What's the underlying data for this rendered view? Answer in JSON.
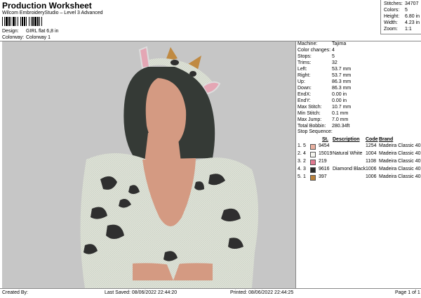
{
  "header": {
    "title": "Production Worksheet",
    "software": "Wilcom EmbroideryStudio – Level 3 Advanced",
    "design_label": "Design:",
    "design_value": "GIRL flat 6,8 in",
    "colorway_label": "Colorway:",
    "colorway_value": "Colorway 1"
  },
  "stats": [
    {
      "label": "Stitches:",
      "value": "34707"
    },
    {
      "label": "Colors:",
      "value": "5"
    },
    {
      "label": "Height:",
      "value": "6.80 in"
    },
    {
      "label": "Width:",
      "value": "4.23 in"
    },
    {
      "label": "Zoom:",
      "value": "1:1"
    }
  ],
  "info": [
    {
      "label": "Machine:",
      "value": "Tajima"
    },
    {
      "label": "Color changes:",
      "value": "4"
    },
    {
      "label": "Stops:",
      "value": "5"
    },
    {
      "label": "Trims:",
      "value": "32"
    },
    {
      "label": "Left:",
      "value": "53.7 mm"
    },
    {
      "label": "Right:",
      "value": "53.7 mm"
    },
    {
      "label": "Up:",
      "value": "86.3 mm"
    },
    {
      "label": "Down:",
      "value": "86.3 mm"
    },
    {
      "label": "EndX:",
      "value": "0.00 in"
    },
    {
      "label": "EndY:",
      "value": "0.00 in"
    },
    {
      "label": "Max Stitch:",
      "value": "10.7 mm"
    },
    {
      "label": "Min Stitch:",
      "value": "0.1 mm"
    },
    {
      "label": "Max Jump:",
      "value": "7.0 mm"
    },
    {
      "label": "Total Bobbin:",
      "value": "280.34ft"
    }
  ],
  "stop_sequence": {
    "title": "Stop Sequence:",
    "headers": {
      "st": "St.",
      "description": "Description",
      "code": "Code",
      "brand": "Brand"
    },
    "rows": [
      {
        "n": "1.",
        "stop": "5",
        "color": "#e8b0a0",
        "st": "9454",
        "description": "",
        "code": "1254",
        "brand": "Madeira Classic 40"
      },
      {
        "n": "2.",
        "stop": "4",
        "color": "#f4f4ee",
        "st": "15019",
        "description": "Natural White",
        "code": "1004",
        "brand": "Madeira Classic 40"
      },
      {
        "n": "3.",
        "stop": "2",
        "color": "#e07890",
        "st": "219",
        "description": "",
        "code": "1108",
        "brand": "Madeira Classic 40"
      },
      {
        "n": "4.",
        "stop": "3",
        "color": "#2a2a2a",
        "st": "9616",
        "description": "Diamond Black",
        "code": "1006",
        "brand": "Madeira Classic 40"
      },
      {
        "n": "5.",
        "stop": "1",
        "color": "#b8803a",
        "st": "397",
        "description": "",
        "code": "1006",
        "brand": "Madeira Classic 40"
      }
    ]
  },
  "footer": {
    "created_by": "Created By:",
    "last_saved": "Last Saved: 08/06/2022 22:44:20",
    "printed": "Printed: 08/06/2022 22:44:25",
    "page": "Page 1 of 1"
  }
}
